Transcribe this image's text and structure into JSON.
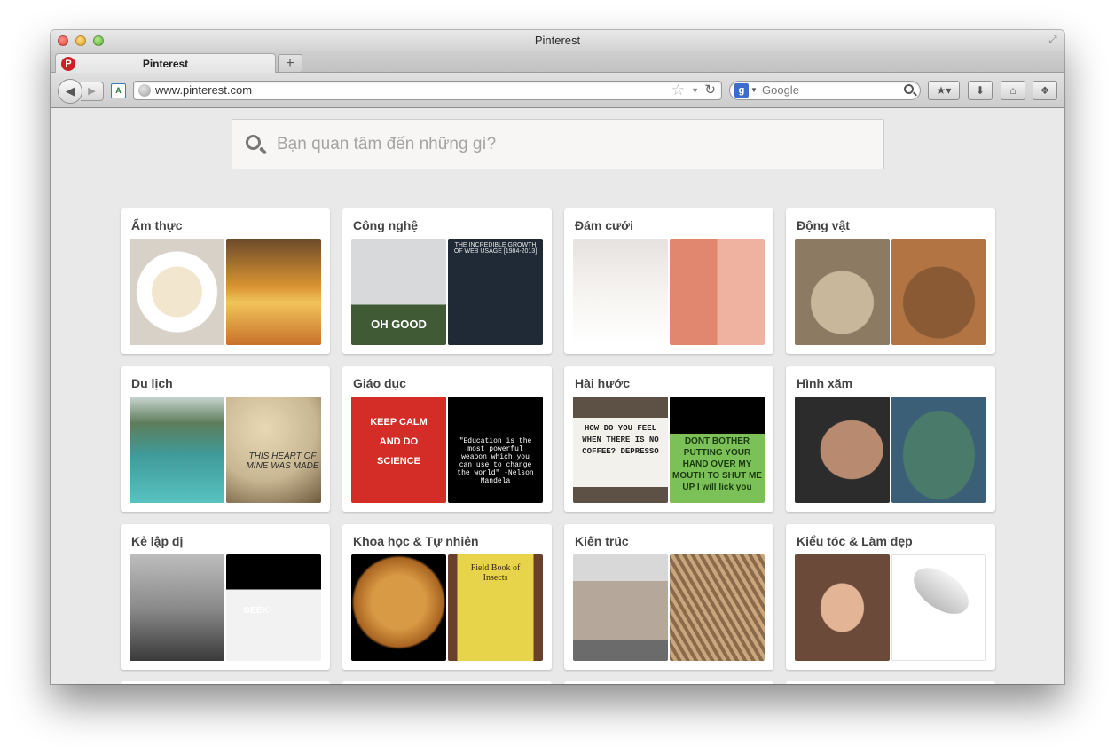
{
  "window": {
    "title": "Pinterest"
  },
  "tab": {
    "title": "Pinterest",
    "favicon": "P"
  },
  "newtab": {
    "label": "+"
  },
  "nav": {
    "back": "◀",
    "forward": "▶"
  },
  "translate": {
    "label": "A"
  },
  "url": {
    "value": "www.pinterest.com"
  },
  "urlbar_icons": {
    "star": "☆",
    "dropdown": "▼",
    "reload": "↻"
  },
  "websearch": {
    "engine_icon": "g",
    "caret": "▼",
    "placeholder": "Google"
  },
  "toolbar_buttons": [
    {
      "name": "bookmarks-button",
      "glyph": "★▾"
    },
    {
      "name": "downloads-button",
      "glyph": "⬇"
    },
    {
      "name": "home-button",
      "glyph": "⌂"
    },
    {
      "name": "sync-button",
      "glyph": "❖"
    }
  ],
  "pin_search": {
    "placeholder": "Bạn quan tâm đến những gì?"
  },
  "categories": [
    {
      "title": "Ẩm thực",
      "left": "#d7d1c8",
      "right": "#d99432"
    },
    {
      "title": "Công nghệ",
      "left": "#9aa0a3",
      "right": "#1f2a36",
      "left_text": "OH GOOD",
      "right_text": "THE INCREDIBLE GROWTH OF WEB USAGE [1984-2013]"
    },
    {
      "title": "Đám cưới",
      "left": "#e6e2df",
      "right": "#e2876f"
    },
    {
      "title": "Động vật",
      "left": "#8c7a62",
      "right": "#b27443"
    },
    {
      "title": "Du lịch",
      "left": "#3f9b9a",
      "right": "#c9b793",
      "right_text": "THIS HEART OF MINE WAS MADE"
    },
    {
      "title": "Giáo dục",
      "left": "#d42d27",
      "right": "#000000",
      "left_text": "KEEP CALM AND DO SCIENCE",
      "right_text": "\"Education is the most powerful weapon which you can use to change the world\" -Nelson Mandela"
    },
    {
      "title": "Hài hước",
      "left": "#5d5045",
      "right": "#7cc157",
      "left_text": "HOW DO YOU FEEL WHEN THERE IS NO COFFEE? DEPRESSO",
      "right_text": "DONT BOTHER PUTTING YOUR HAND OVER MY MOUTH TO SHUT ME UP I will lick you"
    },
    {
      "title": "Hình xăm",
      "left": "#2c2c2c",
      "right": "#3c5f78"
    },
    {
      "title": "Kẻ lập dị",
      "left": "#8b8b8b",
      "right": "#f2f2f2",
      "right_text": "GEEK"
    },
    {
      "title": "Khoa học & Tự nhiên",
      "left": "#000000",
      "right": "#6a3f2b",
      "right_text": "Field Book of Insects"
    },
    {
      "title": "Kiến trúc",
      "left": "#b5a89a",
      "right": "#8a6a4b"
    },
    {
      "title": "Kiểu tóc & Làm đẹp",
      "left": "#6b4a3a",
      "right": "#ffffff"
    }
  ]
}
